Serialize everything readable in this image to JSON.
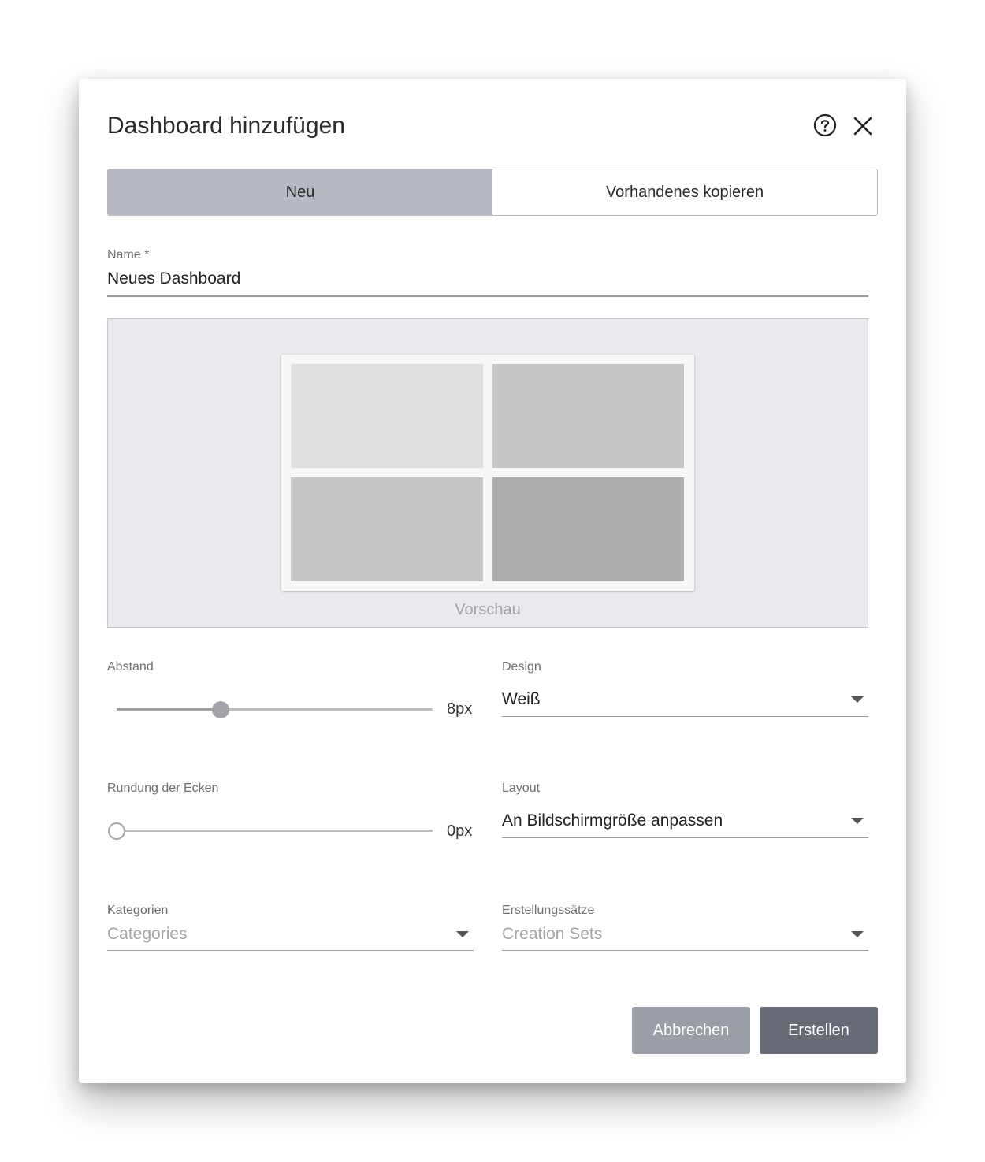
{
  "dialog": {
    "title": "Dashboard hinzufügen",
    "help_icon": "help-circle-icon",
    "close_icon": "close-icon"
  },
  "tabs": [
    {
      "label": "Neu",
      "active": true
    },
    {
      "label": "Vorhandenes kopieren",
      "active": false
    }
  ],
  "name_field": {
    "label": "Name *",
    "value": "Neues Dashboard"
  },
  "preview": {
    "label": "Vorschau",
    "tile_colors": [
      "#e0e0e0",
      "#c6c6c6",
      "#c6c6c6",
      "#adadad"
    ]
  },
  "abstand": {
    "label": "Abstand",
    "value": "8px",
    "fraction": 0.33
  },
  "rundung": {
    "label": "Rundung der Ecken",
    "value": "0px",
    "fraction": 0
  },
  "design": {
    "label": "Design",
    "value": "Weiß"
  },
  "layout": {
    "label": "Layout",
    "value": "An Bildschirmgröße anpassen"
  },
  "kategorien": {
    "label": "Kategorien",
    "placeholder": "Categories"
  },
  "erstellungssaetze": {
    "label": "Erstellungssätze",
    "placeholder": "Creation Sets"
  },
  "actions": {
    "cancel_label": "Abbrechen",
    "create_label": "Erstellen",
    "cancel_color": "#9a9ea6",
    "create_color": "#666b75"
  },
  "colors": {
    "active_tab": "#b7bac1",
    "slider_thumb": "#a3a5aa",
    "preview_bg": "#e9eaed"
  }
}
